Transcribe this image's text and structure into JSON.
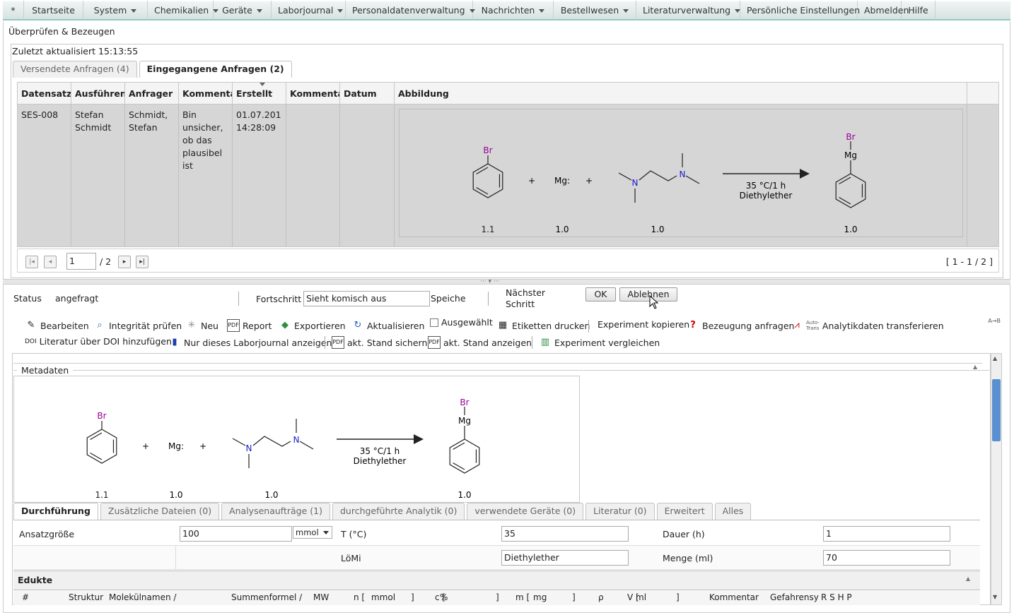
{
  "menu": [
    "*",
    "Startseite",
    "System",
    "Chemikalien",
    "Geräte",
    "Laborjournal",
    "Personaldatenverwaltung",
    "Nachrichten",
    "Bestellwesen",
    "Literaturverwaltung",
    "Persönliche Einstellungen",
    "Abmelden",
    "Hilfe"
  ],
  "menu_dropdown": [
    false,
    false,
    true,
    true,
    true,
    true,
    true,
    true,
    true,
    true,
    false,
    false,
    false
  ],
  "page_title": "Überprüfen & Bezeugen",
  "updated": "Zuletzt aktualisiert 15:13:55",
  "tabs": [
    "Versendete Anfragen (4)",
    "Eingegangene Anfragen (2)"
  ],
  "columns": [
    "Datensatz",
    "Ausführen",
    "Anfrager",
    "Kommenta",
    "Erstellt",
    "Kommenta",
    "Datum",
    "Abbildung"
  ],
  "row": {
    "datensatz": "SES-008",
    "ausfuehrender": "Stefan Schmidt",
    "anfrager": "Schmidt, Stefan",
    "kommentar": "Bin unsicher, ob das plausibel ist",
    "erstellt": "01.07.201 14:28:09"
  },
  "reaction": {
    "reagent1": "Br",
    "mg": "Mg:",
    "plus": "+",
    "n": "N",
    "conditions1": "35 °C/1 h",
    "conditions2": "Diethylether",
    "product_br": "Br",
    "product_mg": "Mg",
    "eq": [
      "1.1",
      "1.0",
      "1.0",
      "1.0"
    ]
  },
  "pager": {
    "page": "1",
    "total": "/ 2",
    "range": "[ 1 - 1 / 2 ]"
  },
  "status": {
    "label": "Status",
    "value": "angefragt",
    "fortschritt_label": "Fortschritt",
    "fortschritt_value": "Sieht komisch aus",
    "speichern": "Speiche",
    "naechster": "Nächster Schritt",
    "ok": "OK",
    "ablehnen": "Ablehnen"
  },
  "toolbar_row1": [
    "Bearbeiten",
    "Integrität prüfen",
    "Neu",
    "Report",
    "Exportieren",
    "Aktualisieren",
    "Ausgewählt",
    "Etiketten drucken",
    "Experiment kopieren",
    "Bezeugung anfragen",
    "Analytikdaten transferieren"
  ],
  "toolbar_row2": [
    "Literatur über DOI hinzufügen",
    "Nur dieses Laborjournal anzeigen",
    "akt. Stand sichern",
    "akt. Stand anzeigen",
    "Experiment vergleichen"
  ],
  "toolbar_small": {
    "doi": "DOI",
    "autotrans1": "Auto-",
    "autotrans2": "Trans",
    "atob": "A→B",
    "pdf": "PDF"
  },
  "metadaten": "Metadaten",
  "detail_tabs": [
    "Durchführung",
    "Zusätzliche Dateien (0)",
    "Analysenaufträge (1)",
    "durchgeführte Analytik (0)",
    "verwendete Geräte (0)",
    "Literatur (0)",
    "Erweitert",
    "Alles"
  ],
  "form": {
    "ansatz_label": "Ansatzgröße",
    "ansatz_value": "100",
    "unit": "mmol",
    "t_label": "T (°C)",
    "t_value": "35",
    "dauer_label": "Dauer (h)",
    "dauer_value": "1",
    "loemi_label": "LöMi",
    "loemi_value": "Diethylether",
    "menge_label": "Menge (ml)",
    "menge_value": "70"
  },
  "edukte": "Edukte",
  "edukte_cols": [
    "#",
    "Struktur",
    "Molekülnamen /",
    "Summenformel /",
    "MW",
    "n [",
    "mmol",
    "]",
    "c [",
    "%",
    "]",
    "m [",
    "mg",
    "]",
    "ρ",
    "V [",
    "ml",
    "]",
    "Kommentar",
    "Gefahrensy",
    "R S H P"
  ]
}
